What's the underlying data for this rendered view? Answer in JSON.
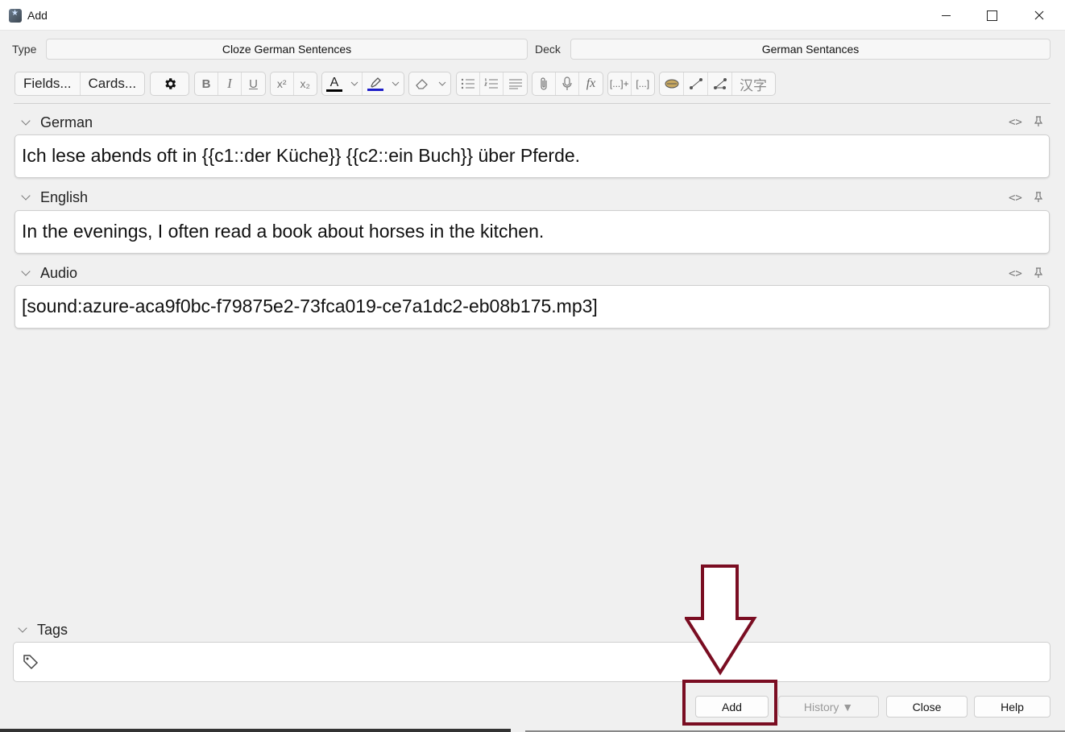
{
  "window": {
    "title": "Add"
  },
  "note_type": {
    "label": "Type",
    "value": "Cloze German Sentences"
  },
  "deck": {
    "label": "Deck",
    "value": "German Sentances"
  },
  "toolbar": {
    "fields_label": "Fields...",
    "cards_label": "Cards...",
    "bold": "B",
    "italic": "I",
    "underline": "U",
    "superscript": "x²",
    "subscript": "x₂",
    "text_color": "A",
    "text_color_value": "#000000",
    "highlight_color_value": "#1e1ec8",
    "function": "fx",
    "cloze": "[...]+",
    "cloze_same": "[...]",
    "japanese": "汉字"
  },
  "fields": [
    {
      "name": "German",
      "value": "Ich lese abends oft in {{c1::der Küche}} {{c2::ein Buch}} über Pferde."
    },
    {
      "name": "English",
      "value": "In the evenings, I often read a book about horses in the kitchen."
    },
    {
      "name": "Audio",
      "value": "[sound:azure-aca9f0bc-f79875e2-73fca019-ce7a1dc2-eb08b175.mp3]"
    }
  ],
  "tags": {
    "label": "Tags",
    "value": ""
  },
  "buttons": {
    "add": "Add",
    "history": "History ▼",
    "close": "Close",
    "help": "Help"
  },
  "colors": {
    "highlight": "#7a0d22"
  }
}
